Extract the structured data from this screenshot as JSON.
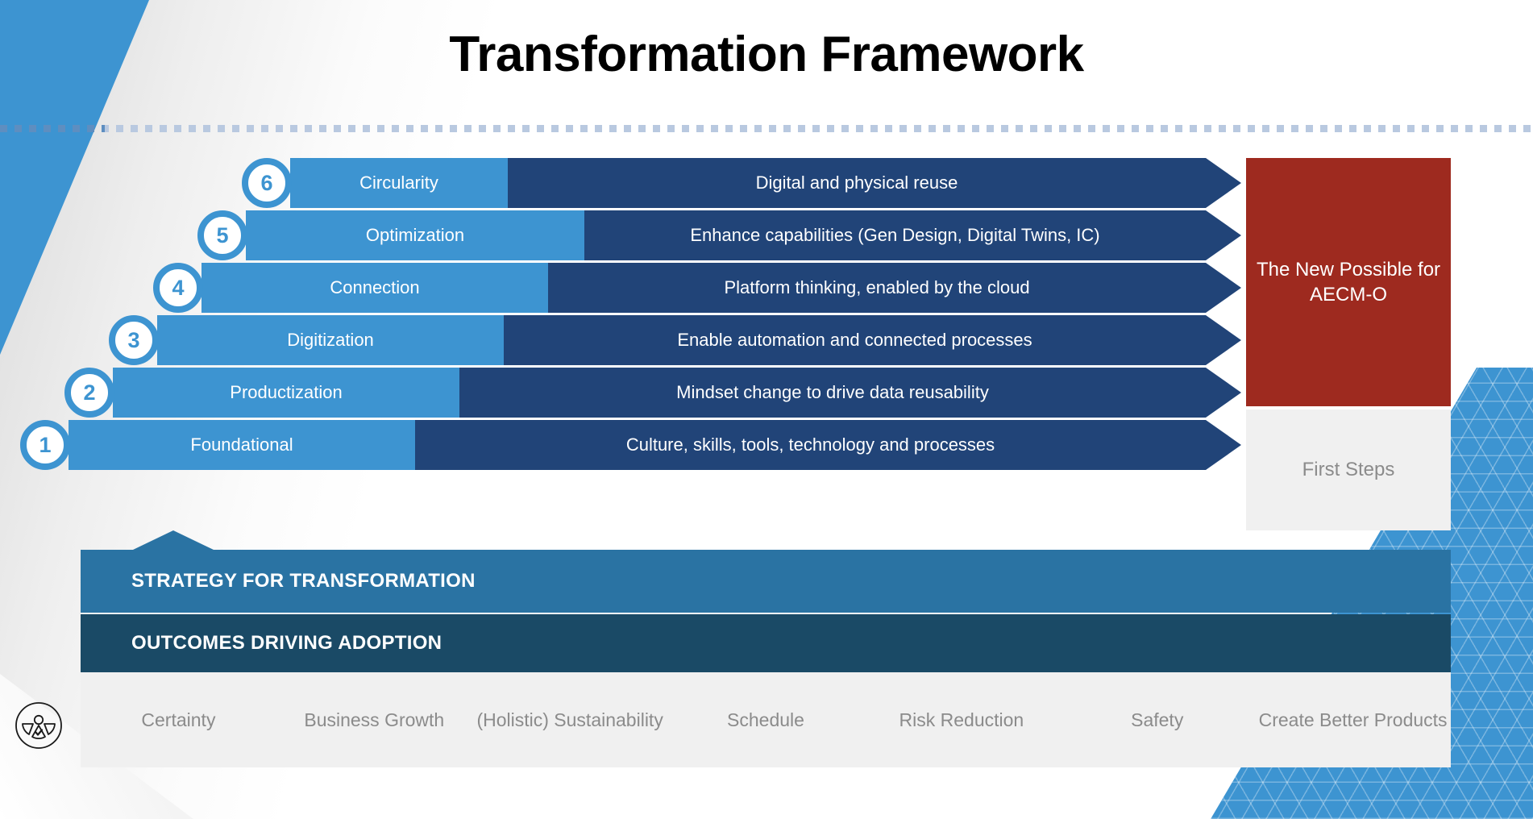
{
  "slide": {
    "title": "Transformation Framework",
    "colors": {
      "light_blue": "#3d94d1",
      "dark_blue": "#214478",
      "strategy_band": "#2a73a3",
      "outcomes_band": "#1a4a66",
      "red_box": "#9e2a1f",
      "gray_box": "#f0f0f0",
      "gray_text": "#8b8b8b"
    }
  },
  "stairs": [
    {
      "number": "6",
      "stage": "Circularity",
      "description": "Digital and physical reuse"
    },
    {
      "number": "5",
      "stage": "Optimization",
      "description": "Enhance capabilities (Gen Design, Digital Twins, IC)"
    },
    {
      "number": "4",
      "stage": "Connection",
      "description": "Platform thinking, enabled by the cloud"
    },
    {
      "number": "3",
      "stage": "Digitization",
      "description": "Enable automation and connected processes"
    },
    {
      "number": "2",
      "stage": "Productization",
      "description": "Mindset change to drive data reusability"
    },
    {
      "number": "1",
      "stage": "Foundational",
      "description": "Culture, skills, tools, technology and processes"
    }
  ],
  "side_boxes": {
    "top": "The New Possible for AECM-O",
    "bottom": "First Steps"
  },
  "bands": {
    "strategy": "STRATEGY FOR TRANSFORMATION",
    "outcomes": "OUTCOMES DRIVING ADOPTION"
  },
  "outcomes": [
    "Certainty",
    "Business Growth",
    "(Holistic) Sustainability",
    "Schedule",
    "Risk Reduction",
    "Safety",
    "Create Better Products"
  ],
  "logo": {
    "name": "circular-figure-check-logo"
  }
}
